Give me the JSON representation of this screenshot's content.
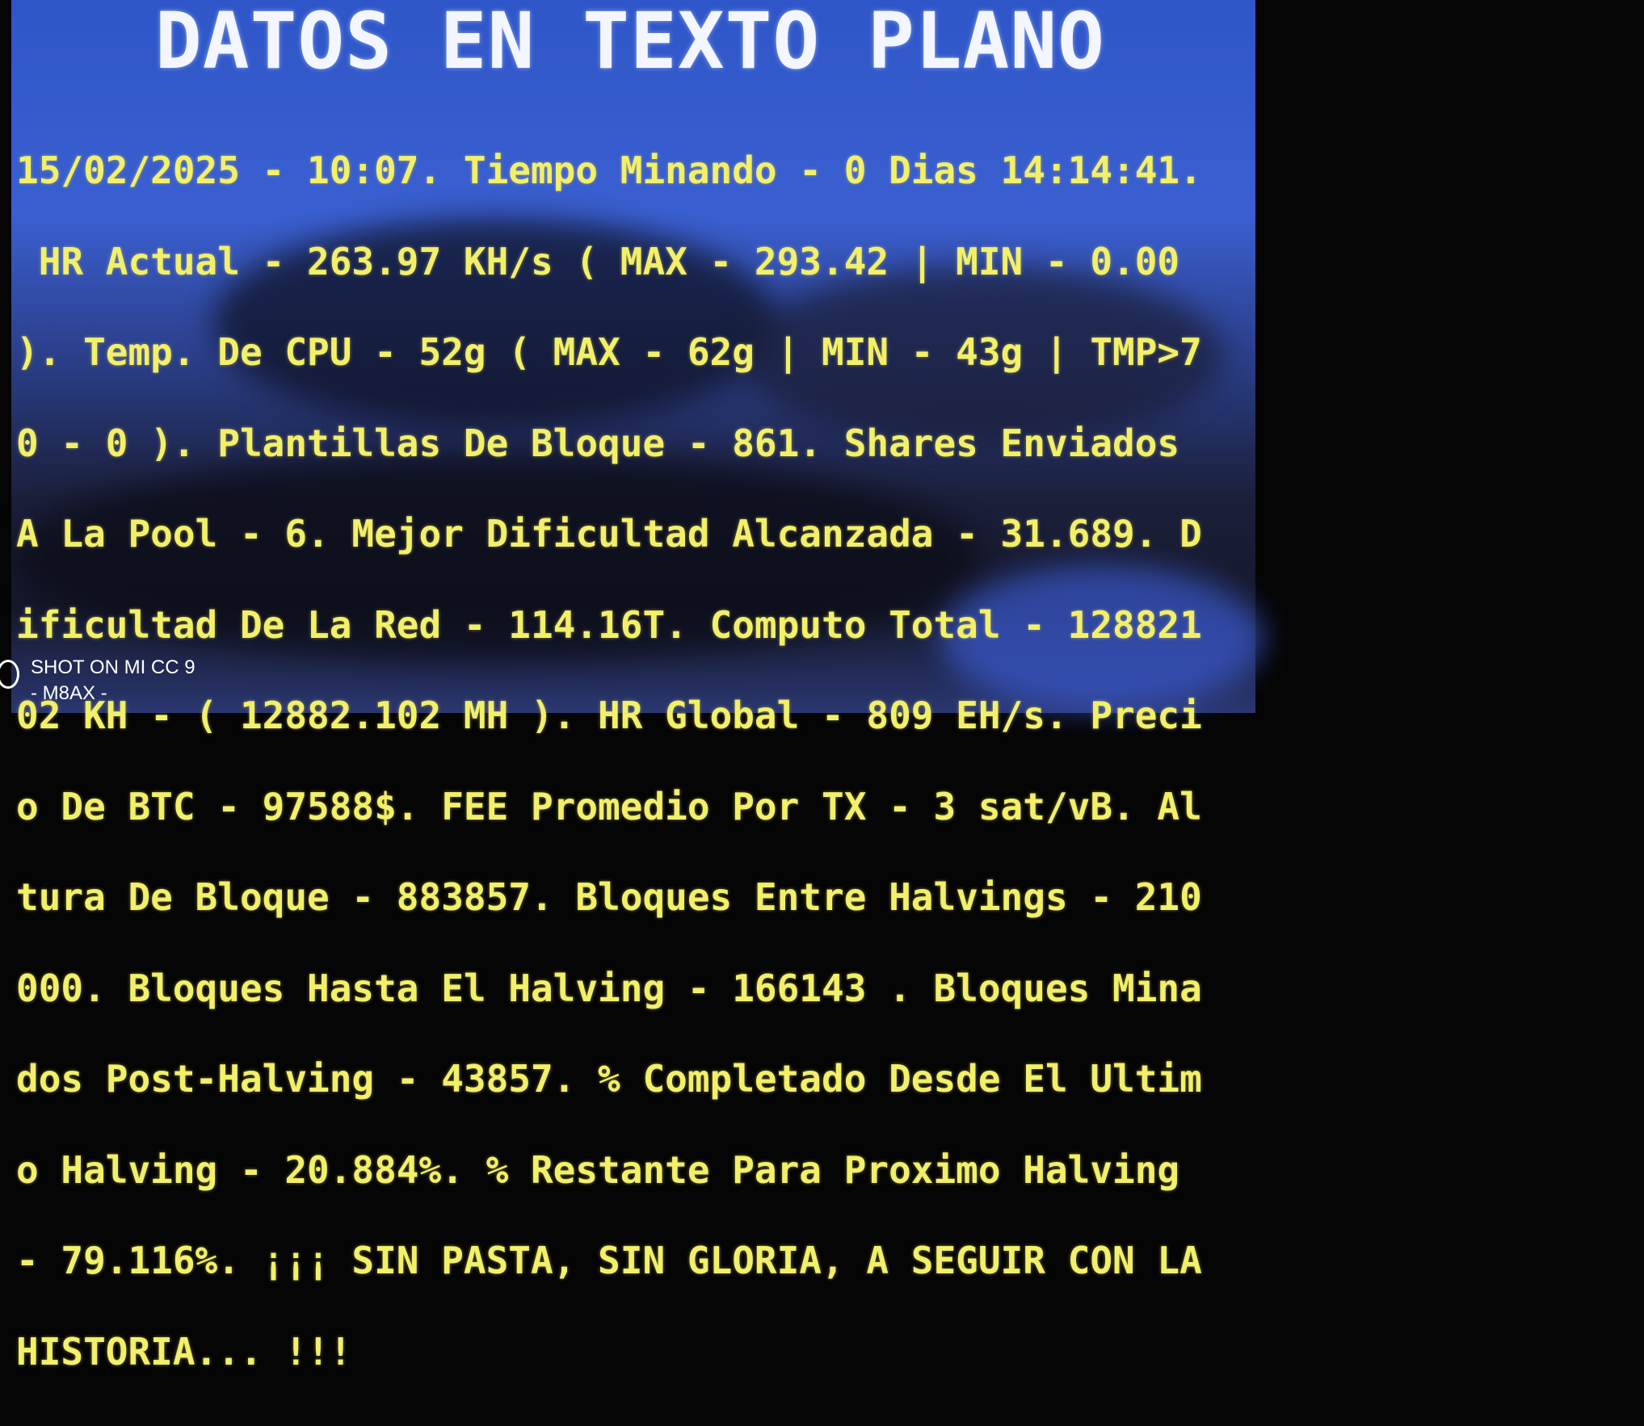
{
  "title": "DATOS EN TEXTO PLANO",
  "lines": [
    "15/02/2025 - 10:07. Tiempo Minando - 0 Dias 14:14:41.",
    " HR Actual - 263.97 KH/s ( MAX - 293.42 | MIN - 0.00",
    "). Temp. De CPU - 52g ( MAX - 62g | MIN - 43g | TMP>7",
    "0 - 0 ). Plantillas De Bloque - 861. Shares Enviados",
    "A La Pool - 6. Mejor Dificultad Alcanzada - 31.689. D",
    "ificultad De La Red - 114.16T. Computo Total - 128821",
    "02 KH - ( 12882.102 MH ). HR Global - 809 EH/s. Preci",
    "o De BTC - 97588$. FEE Promedio Por TX - 3 sat/vB. Al",
    "tura De Bloque - 883857. Bloques Entre Halvings - 210",
    "000. Bloques Hasta El Halving - 166143 . Bloques Mina",
    "dos Post-Halving - 43857. % Completado Desde El Ultim",
    "o Halving - 20.884%. % Restante Para Proximo Halving",
    "- 79.116%. ¡¡¡ SIN PASTA, SIN GLORIA, A SEGUIR CON LA",
    "HISTORIA... !!!"
  ],
  "watermark": {
    "line1": "SHOT ON MI CC 9",
    "line2": "- M8AX -"
  },
  "colors": {
    "text": "#f2ef6a",
    "title": "#f4f6ff",
    "screen": "#3a5fd0"
  }
}
